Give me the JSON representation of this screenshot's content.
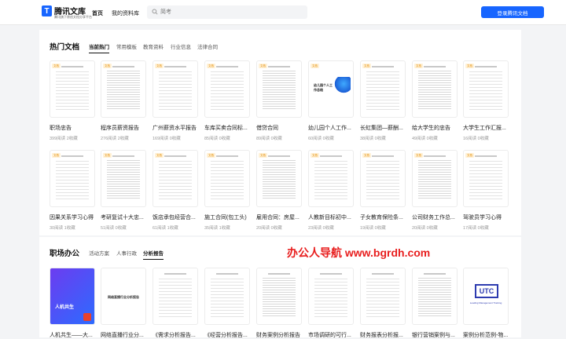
{
  "header": {
    "brand": "腾讯文库",
    "brand_sub": "腾讯旗下原创文档分享平台",
    "logo_glyph": "T",
    "nav": [
      "首页",
      "我的资料库"
    ],
    "search_placeholder": "简考",
    "login_label": "登录腾讯文档"
  },
  "hot": {
    "title": "热门文档",
    "tabs": [
      "当前热门",
      "常用模板",
      "教育资料",
      "行业信息",
      "法律合同"
    ],
    "badge": "文档",
    "row1": [
      {
        "title": "职场忠告",
        "stats": "399阅读 2收藏"
      },
      {
        "title": "程序员薪资报告",
        "stats": "276阅读 2收藏"
      },
      {
        "title": "广州薪资水平报告",
        "stats": "169阅读 0收藏"
      },
      {
        "title": "车库买卖合同标...",
        "stats": "85阅读 0收藏"
      },
      {
        "title": "借贷合同",
        "stats": "89阅读 0收藏"
      },
      {
        "title": "幼儿园个人工作...",
        "stats": "60阅读 0收藏"
      },
      {
        "title": "长虹集团—薪酬...",
        "stats": "38阅读 0收藏"
      },
      {
        "title": "给大学生的忠告",
        "stats": "49阅读 0收藏"
      },
      {
        "title": "大学生工作汇报...",
        "stats": "16阅读 0收藏"
      }
    ],
    "row2": [
      {
        "title": "因果关系学习心得",
        "stats": "30阅读 1收藏"
      },
      {
        "title": "考研复试十大忠...",
        "stats": "51阅读 0收藏"
      },
      {
        "title": "饭店承包经营合...",
        "stats": "61阅读 1收藏"
      },
      {
        "title": "施工合同(包工头)",
        "stats": "35阅读 1收藏"
      },
      {
        "title": "雇用合同：房屋...",
        "stats": "20阅读 0收藏"
      },
      {
        "title": "人教新目标初中...",
        "stats": "23阅读 0收藏"
      },
      {
        "title": "子女教育保险条...",
        "stats": "19阅读 0收藏"
      },
      {
        "title": "公司财务工作总...",
        "stats": "20阅读 0收藏"
      },
      {
        "title": "驾驶员学习心得",
        "stats": "17阅读 0收藏"
      }
    ]
  },
  "office": {
    "title": "职场办公",
    "tabs": [
      "活动方案",
      "人事行政",
      "分析报告"
    ],
    "row": [
      {
        "title": "人机共生——大..."
      },
      {
        "title": "网络直播行业分..."
      },
      {
        "title": "《需求分析报告..."
      },
      {
        "title": "《经营分析报告..."
      },
      {
        "title": "财务案例分析报告"
      },
      {
        "title": "市场调研的可行..."
      },
      {
        "title": "财务报表分析报..."
      },
      {
        "title": "银行营销案例与..."
      },
      {
        "title": "案例分析范例-物..."
      }
    ],
    "cover_texts": {
      "c1": "人机共生",
      "c2": "网络直播行业分析报告",
      "c9": "UTC",
      "c9_sub": "Loading Management Training"
    }
  },
  "cover_texts": {
    "hot_row1_card6": "幼儿园个人工作总结"
  },
  "watermark": "办公人导航  www.bgrdh.com",
  "colors": {
    "accent": "#1765ff",
    "badge": "#e38a00",
    "watermark": "#e81e1e"
  }
}
